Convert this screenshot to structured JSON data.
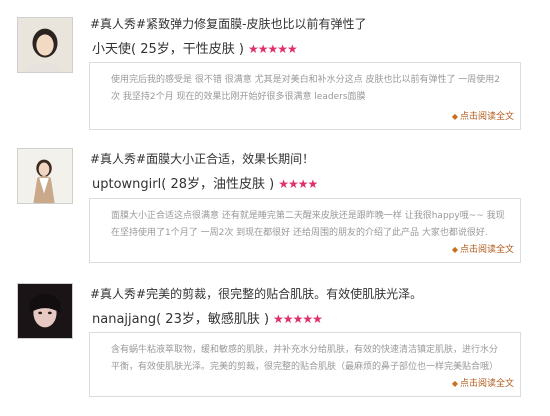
{
  "reviews": [
    {
      "title": "#真人秀#紧致弹力修复面膜-皮肤也比以前有弹性了",
      "author": "小天使",
      "profile": "( 25岁，干性皮肤 )",
      "stars": "★★★★★",
      "body": "使用完后我的感受是 很不错 很满意 尤其是对美白和补水分这点 皮肤也比以前有弹性了 一周使用2次 我坚持2个月 现在的效果比刚开始好很多很满意 leaders面膜",
      "read_more": "点击阅读全文",
      "avatar_icon": "person-photo-icon"
    },
    {
      "title": "#真人秀#面膜大小正合适，效果长期间！",
      "author": "uptowngirl",
      "profile": "( 28岁，油性皮肤 )",
      "stars": "★★★★",
      "body": "面膜大小正合适这点很满意 还有就是睡完第二天醒来皮肤还是跟昨晚一样 让我很happy哦~~ 我现在坚持使用了1个月了 一周2次 到现在都很好 还给周围的朋友的介绍了此产品 大家也都说很好.",
      "read_more": "点击阅读全文",
      "avatar_icon": "person-photo-icon"
    },
    {
      "title": "#真人秀#完美的剪裁，很完整的贴合肌肤。有效使肌肤光泽。",
      "author": "nanajjang",
      "profile": "( 23岁，敏感肌肤 )",
      "stars": "★★★★★",
      "body": "含有蜗牛粘液萃取物，缓和敏感的肌肤，并补充水分给肌肤，有效的快速清洁镇定肌肤，进行水分平衡，有效使肌肤光泽。完美的剪裁，很完整的贴合肌肤（最麻烦的鼻子部位也一样完美贴合哦）",
      "read_more": "点击阅读全文",
      "avatar_icon": "person-photo-icon"
    }
  ]
}
